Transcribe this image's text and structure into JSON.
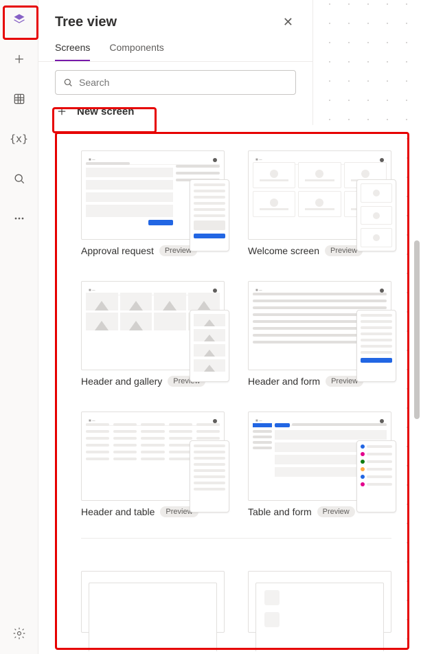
{
  "panel": {
    "title": "Tree view",
    "tabs": {
      "screens": "Screens",
      "components": "Components"
    },
    "search_placeholder": "Search",
    "new_screen_label": "New screen"
  },
  "rail": {
    "icons": [
      "layers",
      "plus",
      "grid",
      "braces",
      "search",
      "more",
      "settings"
    ]
  },
  "templates": [
    {
      "name": "Approval request",
      "badge": "Preview",
      "kind": "approval"
    },
    {
      "name": "Welcome screen",
      "badge": "Preview",
      "kind": "welcome"
    },
    {
      "name": "Header and gallery",
      "badge": "Preview",
      "kind": "gallery"
    },
    {
      "name": "Header and form",
      "badge": "Preview",
      "kind": "form"
    },
    {
      "name": "Header and table",
      "badge": "Preview",
      "kind": "table"
    },
    {
      "name": "Table and form",
      "badge": "Preview",
      "kind": "tableform"
    }
  ]
}
